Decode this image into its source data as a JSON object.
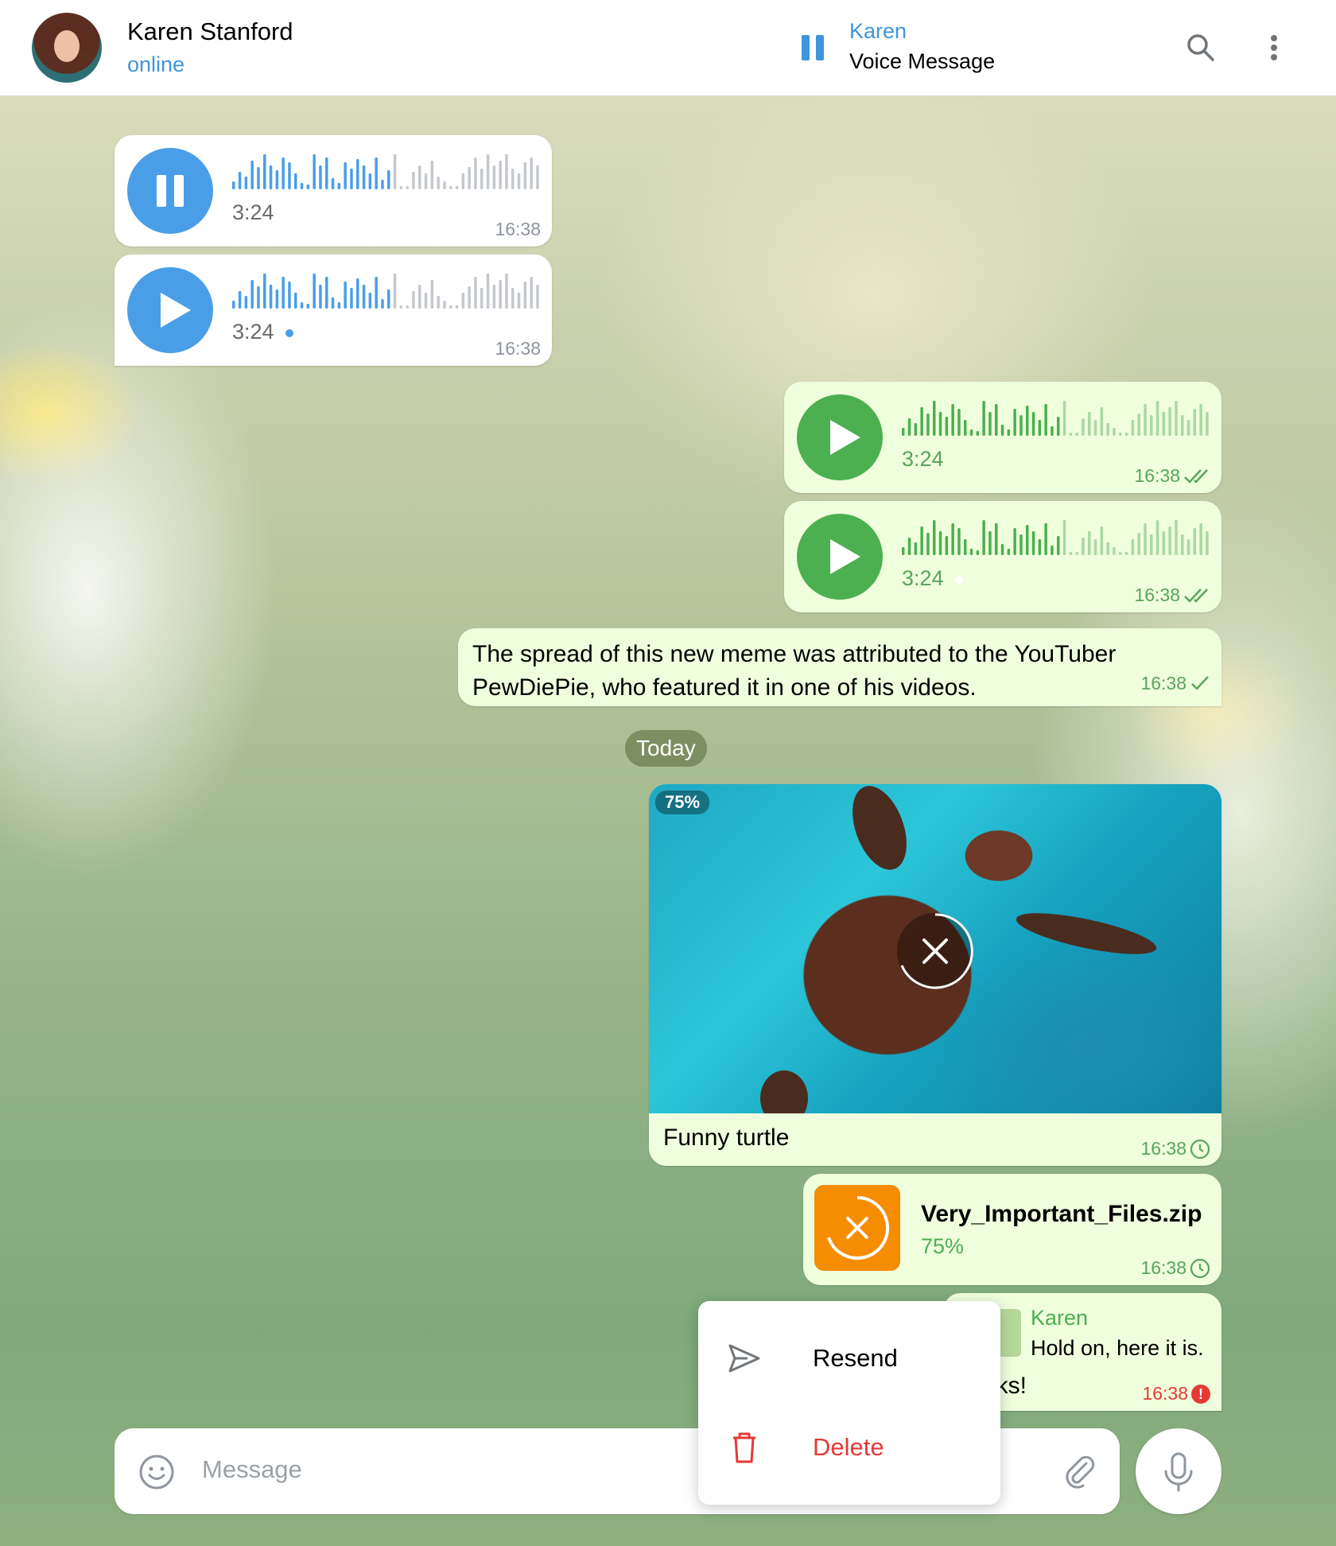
{
  "header": {
    "name": "Karen Stanford",
    "status": "online",
    "pinned_player": {
      "name": "Karen",
      "subtitle": "Voice Message"
    }
  },
  "messages": {
    "voice_in_1": {
      "duration": "3:24",
      "time": "16:38",
      "state": "playing"
    },
    "voice_in_2": {
      "duration": "3:24",
      "time": "16:38",
      "state": "paused"
    },
    "voice_out_1": {
      "duration": "3:24",
      "time": "16:38",
      "status": "read"
    },
    "voice_out_2": {
      "duration": "3:24",
      "time": "16:38",
      "status": "read"
    },
    "text_out": {
      "text": "The spread of this new meme was attributed to the YouTuber PewDiePie, who featured it in one of his videos.",
      "time": "16:38",
      "status": "sent"
    },
    "date_separator": "Today",
    "photo_out": {
      "progress_label": "75%",
      "caption": "Funny turtle",
      "time": "16:38",
      "status": "pending"
    },
    "file_out": {
      "name": "Very_Important_Files.zip",
      "progress_label": "75%",
      "time": "16:38",
      "status": "pending"
    },
    "reply_out": {
      "reply_name": "Karen",
      "reply_text": "Hold on, here it is.",
      "text_partial": "nks!",
      "time": "16:38",
      "status": "error"
    }
  },
  "context_menu": {
    "resend": "Resend",
    "delete": "Delete"
  },
  "composer": {
    "placeholder": "Message"
  },
  "colors": {
    "accent_blue": "#3e95dd",
    "accent_green": "#4caf50",
    "error_red": "#e53935",
    "file_orange": "#f68c00",
    "out_bubble": "#effedd"
  }
}
